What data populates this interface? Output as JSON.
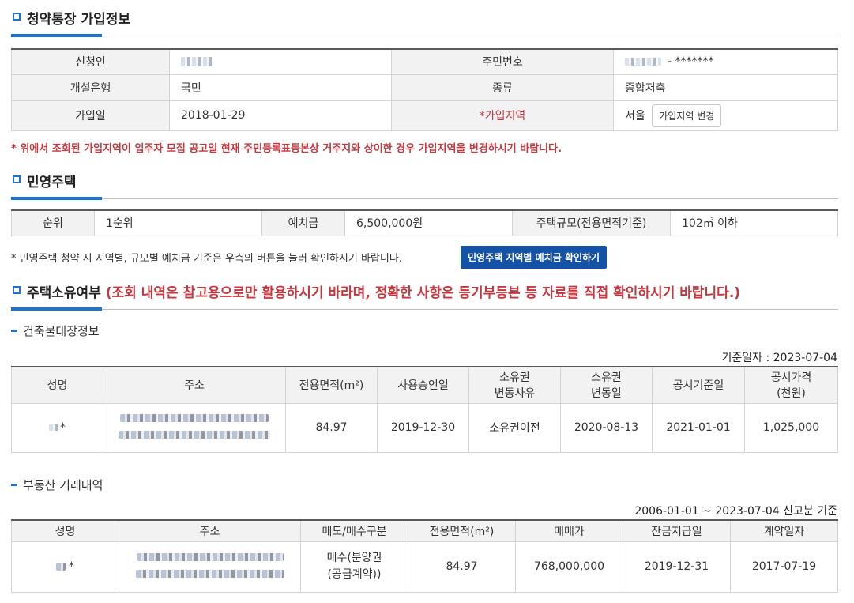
{
  "section1": {
    "title": "청약통장 가입정보",
    "labels": {
      "applicant": "신청인",
      "resident_no": "주민번호",
      "bank": "개설은행",
      "type": "종류",
      "join_date": "가입일",
      "join_region": "*가입지역"
    },
    "values": {
      "resident_no_suffix": "- *******",
      "bank": "국민",
      "type": "종합저축",
      "join_date": "2018-01-29",
      "join_region": "서울"
    },
    "change_region_button": "가입지역 변경",
    "notice": "* 위에서 조회된 가입지역이 입주자 모집 공고일 현재 주민등록표등본상 거주지와 상이한 경우 가입지역을 변경하시기 바랍니다."
  },
  "section2": {
    "title": "민영주택",
    "labels": {
      "rank": "순위",
      "deposit": "예치금",
      "size": "주택규모(전용면적기준)"
    },
    "values": {
      "rank": "1순위",
      "deposit": "6,500,000원",
      "size": "102㎡ 이하"
    },
    "notice": "* 민영주택 청약 시 지역별, 규모별 예치금 기준은 우측의 버튼을 눌러 확인하시기 바랍니다.",
    "check_button": "민영주택 지역별 예치금 확인하기"
  },
  "section3": {
    "title": "주택소유여부",
    "warning": "(조회 내역은 참고용으로만 활용하시기 바라며, 정확한 사항은 등기부등본 등 자료를 직접 확인하시기 바랍니다.)",
    "building": {
      "title": "건축물대장정보",
      "basis": "기준일자 : 2023-07-04",
      "headers": {
        "name": "성명",
        "address": "주소",
        "area": "전용면적(m²)",
        "approval": "사용승인일",
        "reason_1": "소유권",
        "reason_2": "변동사유",
        "change_1": "소유권",
        "change_2": "변동일",
        "notice_date": "공시기준일",
        "price_1": "공시가격",
        "price_2": "(천원)"
      },
      "row": {
        "name_suffix": "*",
        "area": "84.97",
        "approval": "2019-12-30",
        "reason": "소유권이전",
        "change": "2020-08-13",
        "notice_date": "2021-01-01",
        "price": "1,025,000"
      }
    },
    "trade": {
      "title": "부동산 거래내역",
      "basis": "2006-01-01 ~ 2023-07-04 신고분 기준",
      "headers": {
        "name": "성명",
        "address": "주소",
        "type": "매도/매수구분",
        "area": "전용면적(m²)",
        "price": "매매가",
        "balance_date": "잔금지급일",
        "contract_date": "계약일자"
      },
      "row": {
        "name_suffix": "*",
        "type_1": "매수(분양권",
        "type_2": "(공급계약))",
        "area": "84.97",
        "price": "768,000,000",
        "balance_date": "2019-12-31",
        "contract_date": "2017-07-19"
      }
    }
  }
}
